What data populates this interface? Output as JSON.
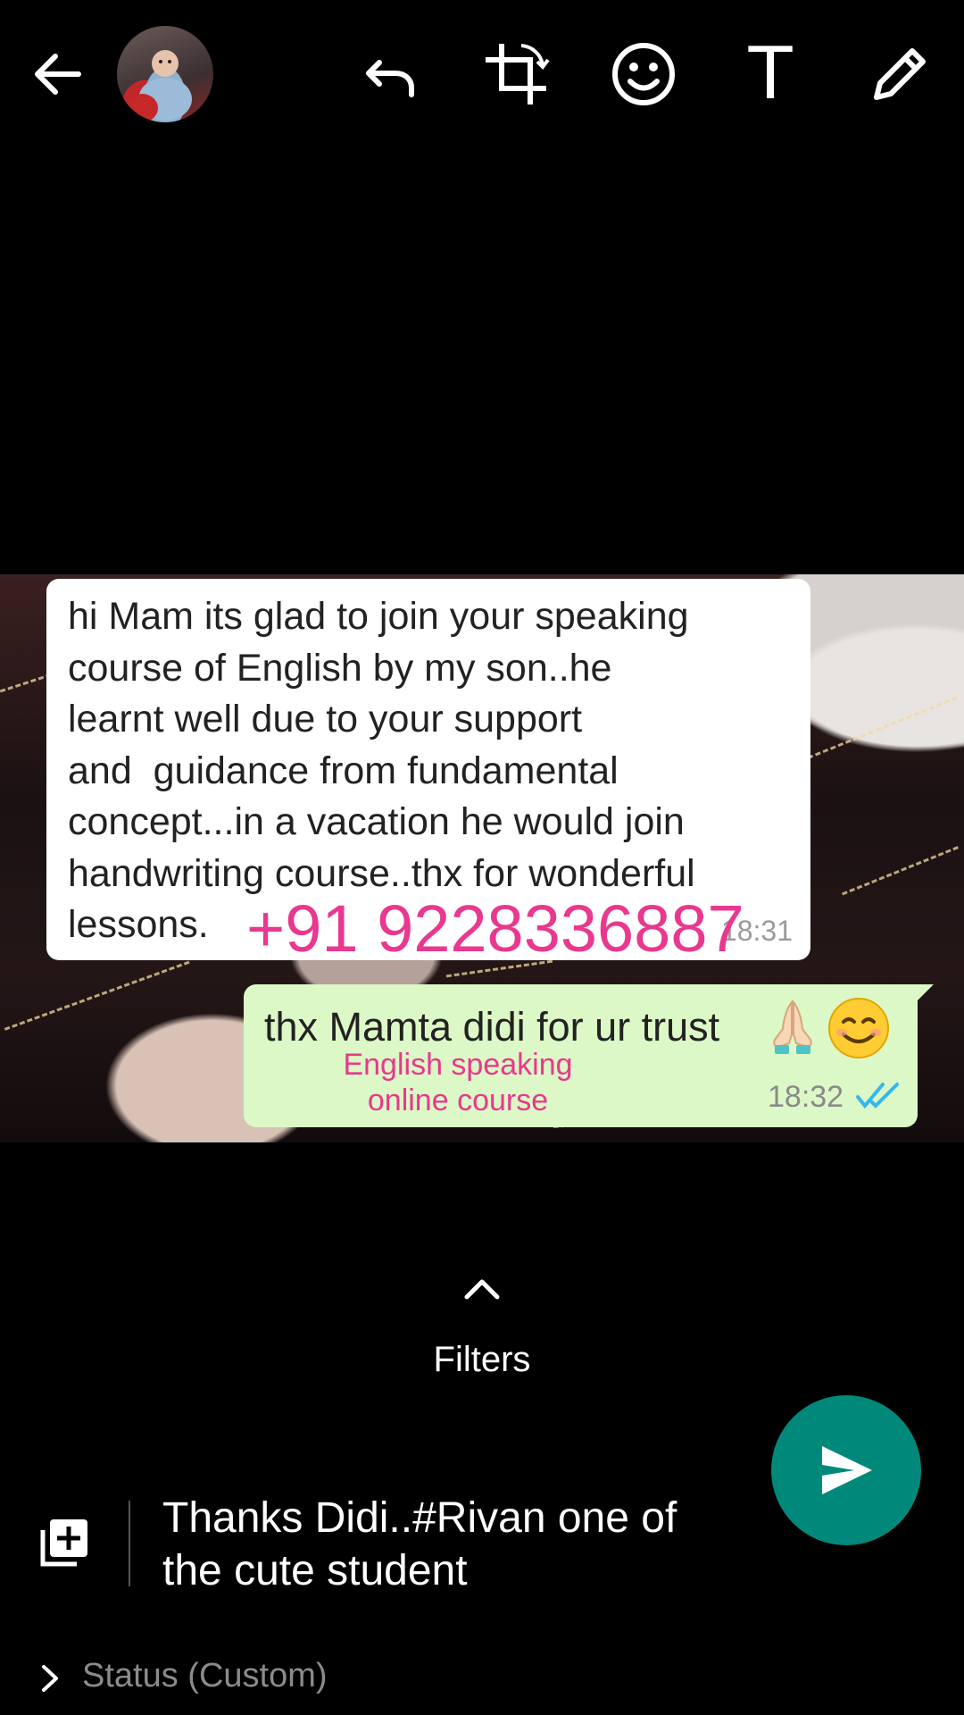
{
  "toolbar": {
    "back_icon": "arrow-left-icon",
    "avatar": "profile-photo",
    "undo_icon": "undo-icon",
    "crop_icon": "crop-rotate-icon",
    "emoji_icon": "smiley-icon",
    "text_tool_label": "T",
    "draw_icon": "pencil-icon"
  },
  "incoming_message": {
    "text": "hi Mam its glad to join your speaking\ncourse of English by my son..he\nlearnt well due to your support\nand  guidance from fundamental\nconcept...in a vacation he would join\nhandwriting course..thx for wonderful\nlessons.",
    "time": "18:31"
  },
  "phone_overlay": "+91 9228336887",
  "outgoing_message": {
    "text": "thx Mamta didi for ur trust",
    "emojis": [
      "folded-hands",
      "smiling-face"
    ],
    "time": "18:32",
    "status_icon": "double-tick-read-icon",
    "tick_color": "#34b7f1"
  },
  "course_overlay": "English speaking\nonline course",
  "filters": {
    "label": "Filters",
    "icon": "chevron-up-icon"
  },
  "caption": {
    "text": "Thanks Didi..#Rivan one of\nthe cute student",
    "add_icon": "add-media-icon"
  },
  "send": {
    "icon": "send-arrow-icon",
    "color": "#00897b"
  },
  "status": {
    "label": "Status (Custom)",
    "icon": "chevron-right-icon"
  },
  "colors": {
    "overlay_text": "#e8388f",
    "outgoing_bubble": "#dcf8c6",
    "incoming_bubble": "#ffffff"
  }
}
